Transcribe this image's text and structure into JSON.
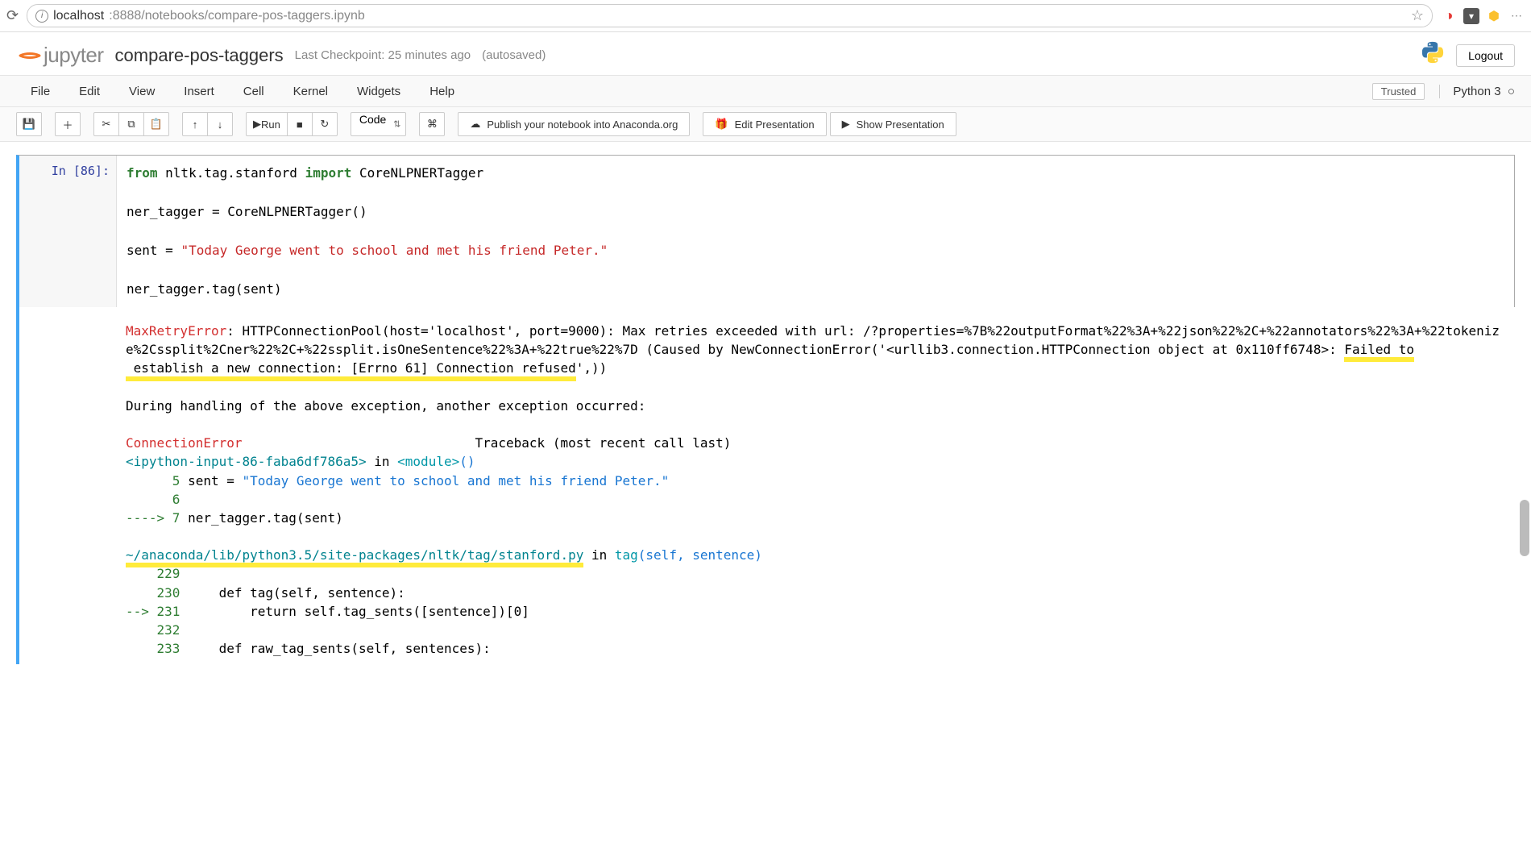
{
  "browser": {
    "url_host": "localhost",
    "url_port_path": ":8888/notebooks/compare-pos-taggers.ipynb"
  },
  "header": {
    "brand": "jupyter",
    "notebook_name": "compare-pos-taggers",
    "checkpoint": "Last Checkpoint: 25 minutes ago",
    "autosaved": "(autosaved)",
    "logout": "Logout"
  },
  "menu": {
    "file": "File",
    "edit": "Edit",
    "view": "View",
    "insert": "Insert",
    "cell": "Cell",
    "kernel": "Kernel",
    "widgets": "Widgets",
    "help": "Help",
    "trusted": "Trusted",
    "kernel_name": "Python 3"
  },
  "toolbar": {
    "run": "Run",
    "celltype": "Code",
    "publish": "Publish your notebook into Anaconda.org",
    "edit_presentation": "Edit Presentation",
    "show_presentation": "Show Presentation"
  },
  "cell": {
    "prompt": "In [86]:",
    "code": {
      "l1a": "from",
      "l1b": " nltk.tag.stanford ",
      "l1c": "import",
      "l1d": " CoreNLPNERTagger",
      "l2": "",
      "l3": "ner_tagger = CoreNLPNERTagger()",
      "l4": "",
      "l5a": "sent = ",
      "l5b": "\"Today George went to school and met his friend Peter.\"",
      "l6": "",
      "l7": "ner_tagger.tag(sent)"
    }
  },
  "output": {
    "err1_name": "MaxRetryError",
    "err1_body1": ": HTTPConnectionPool(host='localhost', port=9000): Max retries exceeded with url: /?properties=%7B%22outputFormat%22%3A+%22json%22%2C+%22annotators%22%3A+%22tokenize%2Cssplit%2Cner%22%2C+%22ssplit.isOneSentence%22%3A+%22true%22%7D (Caused by NewConnectionError('<urllib3.connection.HTTPConnection object at 0x110ff6748>: ",
    "err1_hl1": "Failed to",
    "err1_hl2": " establish a new connection: [Errno 61] Connection refused",
    "err1_tail": "',))",
    "during": "During handling of the above exception, another exception occurred:",
    "err2_name": "ConnectionError",
    "err2_tb": "                              Traceback (most recent call last)",
    "ipy_in": "<ipython-input-86-faba6df786a5>",
    "in_word": " in ",
    "module": "<module>",
    "module_paren": "()",
    "line5_num": "      5",
    "line5_code": " sent = ",
    "line5_str": "\"Today George went to school and met his friend Peter.\"",
    "line6_num": "      6",
    "arrow7": "----> ",
    "line7_num": "7",
    "line7_code": " ner_tagger.tag(sent)",
    "file_path": "~/anaconda/lib/python3.5/site-packages/nltk/tag/stanford.py",
    "in_word2": " in ",
    "tag_fn": "tag",
    "tag_args": "(self, sentence)",
    "ln229": "    229",
    "ln230": "    230",
    "ln230_code": "     def tag(self, sentence):",
    "arrow231": "--> ",
    "ln231": "231",
    "ln231_code": "         return self.tag_sents([sentence])[0]",
    "ln232": "    232",
    "ln233": "    233",
    "ln233_code": "     def raw_tag_sents(self, sentences):"
  }
}
